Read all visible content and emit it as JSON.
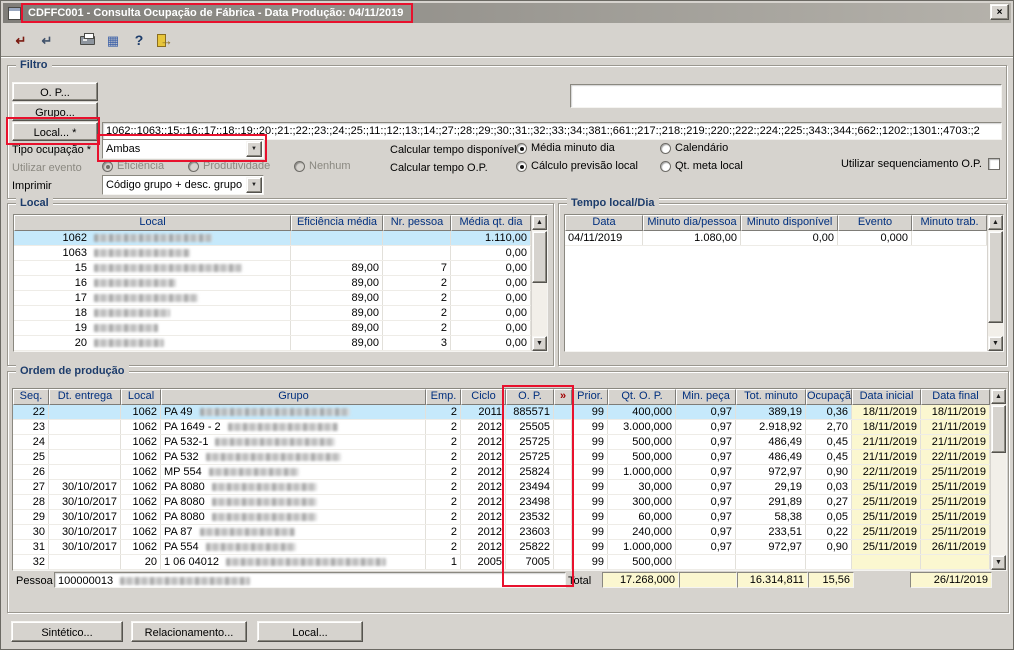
{
  "ui": {
    "arrow_up": "▲",
    "arrow_down": "▼",
    "chevron": "▼",
    "close": "×"
  },
  "annotation_color": "#e8112d",
  "window": {
    "title": "CDFFC001 - Consulta Ocupação de Fábrica - Data Produção: 04/11/2019"
  },
  "toolbar": {
    "icons": [
      {
        "name": "run-icon",
        "glyph": "↵"
      },
      {
        "name": "run-group-icon",
        "glyph": "↵"
      },
      {
        "name": "print-icon",
        "glyph": ""
      },
      {
        "name": "grid-icon",
        "glyph": "▦"
      },
      {
        "name": "help-icon",
        "glyph": "?"
      },
      {
        "name": "exit-icon",
        "glyph": "→"
      }
    ]
  },
  "filtro": {
    "legend": "Filtro",
    "op_button": "O. P...",
    "grupo_button": "Grupo...",
    "local_button": "Local... *",
    "local_list": "1062:;1063:;15:;16:;17:;18:;19:;20:;21:;22:;23:;24:;25:;11:;12:;13:;14:;27:;28:;29:;30:;31:;32:;33:;34:;381:;661:;217:;218:;219:;220:;222:;224:;225:;343:;344:;662:;1202:;1301:;4703:;2",
    "tipo_label": "Tipo ocupação *",
    "tipo_value": "Ambas",
    "evento_label": "Utilizar evento",
    "evento_options": [
      "Eficiência",
      "Produtividade",
      "Nenhum"
    ],
    "calc_disp_label": "Calcular tempo disponível",
    "calc_disp_options": [
      "Média minuto dia",
      "Calendário"
    ],
    "calc_op_label": "Calcular tempo O.P.",
    "calc_op_options": [
      "Cálculo previsão local",
      "Qt. meta local"
    ],
    "seq_label": "Utilizar sequenciamento O.P.",
    "imprimir_label": "Imprimir",
    "imprimir_value": "Código grupo + desc. grupo"
  },
  "local_panel": {
    "legend": "Local",
    "headers": [
      "Local",
      "Eficiência média",
      "Nr. pessoa",
      "Média qt. dia"
    ],
    "rows": [
      {
        "local": "1062",
        "blur": 118,
        "ef": "",
        "np": "",
        "mq": "1.110,00",
        "selected": true
      },
      {
        "local": "1063",
        "blur": 96,
        "ef": "",
        "np": "",
        "mq": "0,00"
      },
      {
        "local": "15",
        "blur": 148,
        "ef": "89,00",
        "np": "7",
        "mq": "0,00"
      },
      {
        "local": "16",
        "blur": 82,
        "ef": "89,00",
        "np": "2",
        "mq": "0,00"
      },
      {
        "local": "17",
        "blur": 104,
        "ef": "89,00",
        "np": "2",
        "mq": "0,00"
      },
      {
        "local": "18",
        "blur": 76,
        "ef": "89,00",
        "np": "2",
        "mq": "0,00"
      },
      {
        "local": "19",
        "blur": 64,
        "ef": "89,00",
        "np": "2",
        "mq": "0,00"
      },
      {
        "local": "20",
        "blur": 70,
        "ef": "89,00",
        "np": "3",
        "mq": "0,00"
      }
    ]
  },
  "tempo_panel": {
    "legend": "Tempo local/Dia",
    "headers": [
      "Data",
      "Minuto dia/pessoa",
      "Minuto disponível",
      "Evento",
      "Minuto trab."
    ],
    "rows": [
      {
        "data": "04/11/2019",
        "mdp": "1.080,00",
        "md": "0,00",
        "ev": "0,000",
        "mt": ""
      }
    ]
  },
  "ordem_panel": {
    "legend": "Ordem de produção",
    "headers": [
      "Seq.",
      "Dt. entrega",
      "Local",
      "Grupo",
      "Emp.",
      "Ciclo",
      "O. P.",
      "»",
      "Prior.",
      "Qt. O. P.",
      "Min. peça",
      "Tot. minuto",
      "Ocupação",
      "Data inicial",
      "Data final"
    ],
    "rows": [
      {
        "seq": "22",
        "dt": "",
        "local": "1062",
        "grupo": "PA 49",
        "blur": 150,
        "emp": "2",
        "ciclo": "2011",
        "op": "885571",
        "prior": "99",
        "qt": "400,000",
        "min": "0,97",
        "tot": "389,19",
        "ocup": "0,36",
        "di": "18/11/2019",
        "df": "18/11/2019",
        "selected": true
      },
      {
        "seq": "23",
        "dt": "",
        "local": "1062",
        "grupo": "PA 1649 - 2",
        "blur": 110,
        "emp": "2",
        "ciclo": "2012",
        "op": "25505",
        "prior": "99",
        "qt": "3.000,000",
        "min": "0,97",
        "tot": "2.918,92",
        "ocup": "2,70",
        "di": "18/11/2019",
        "df": "21/11/2019"
      },
      {
        "seq": "24",
        "dt": "",
        "local": "1062",
        "grupo": "PA 532-1",
        "blur": 120,
        "emp": "2",
        "ciclo": "2012",
        "op": "25725",
        "prior": "99",
        "qt": "500,000",
        "min": "0,97",
        "tot": "486,49",
        "ocup": "0,45",
        "di": "21/11/2019",
        "df": "21/11/2019"
      },
      {
        "seq": "25",
        "dt": "",
        "local": "1062",
        "grupo": "PA 532",
        "blur": 135,
        "emp": "2",
        "ciclo": "2012",
        "op": "25725",
        "prior": "99",
        "qt": "500,000",
        "min": "0,97",
        "tot": "486,49",
        "ocup": "0,45",
        "di": "21/11/2019",
        "df": "22/11/2019"
      },
      {
        "seq": "26",
        "dt": "",
        "local": "1062",
        "grupo": "MP 554",
        "blur": 90,
        "emp": "2",
        "ciclo": "2012",
        "op": "25824",
        "prior": "99",
        "qt": "1.000,000",
        "min": "0,97",
        "tot": "972,97",
        "ocup": "0,90",
        "di": "22/11/2019",
        "df": "25/11/2019"
      },
      {
        "seq": "27",
        "dt": "30/10/2017",
        "local": "1062",
        "grupo": "PA 8080",
        "blur": 105,
        "emp": "2",
        "ciclo": "2012",
        "op": "23494",
        "prior": "99",
        "qt": "30,000",
        "min": "0,97",
        "tot": "29,19",
        "ocup": "0,03",
        "di": "25/11/2019",
        "df": "25/11/2019"
      },
      {
        "seq": "28",
        "dt": "30/10/2017",
        "local": "1062",
        "grupo": "PA 8080",
        "blur": 105,
        "emp": "2",
        "ciclo": "2012",
        "op": "23498",
        "prior": "99",
        "qt": "300,000",
        "min": "0,97",
        "tot": "291,89",
        "ocup": "0,27",
        "di": "25/11/2019",
        "df": "25/11/2019"
      },
      {
        "seq": "29",
        "dt": "30/10/2017",
        "local": "1062",
        "grupo": "PA 8080",
        "blur": 105,
        "emp": "2",
        "ciclo": "2012",
        "op": "23532",
        "prior": "99",
        "qt": "60,000",
        "min": "0,97",
        "tot": "58,38",
        "ocup": "0,05",
        "di": "25/11/2019",
        "df": "25/11/2019"
      },
      {
        "seq": "30",
        "dt": "30/10/2017",
        "local": "1062",
        "grupo": "PA 87",
        "blur": 95,
        "emp": "2",
        "ciclo": "2012",
        "op": "23603",
        "prior": "99",
        "qt": "240,000",
        "min": "0,97",
        "tot": "233,51",
        "ocup": "0,22",
        "di": "25/11/2019",
        "df": "25/11/2019"
      },
      {
        "seq": "31",
        "dt": "30/10/2017",
        "local": "1062",
        "grupo": "PA 554",
        "blur": 90,
        "emp": "2",
        "ciclo": "2012",
        "op": "25822",
        "prior": "99",
        "qt": "1.000,000",
        "min": "0,97",
        "tot": "972,97",
        "ocup": "0,90",
        "di": "25/11/2019",
        "df": "26/11/2019"
      },
      {
        "seq": "32",
        "dt": "",
        "local": "20",
        "grupo": "1 06 04012",
        "blur": 160,
        "emp": "1",
        "ciclo": "2005",
        "op": "7005",
        "prior": "99",
        "qt": "500,000",
        "min": "",
        "tot": "",
        "ocup": "",
        "di": "",
        "df": ""
      }
    ],
    "pessoa_label": "Pessoa",
    "pessoa_code": "100000013",
    "total_label": "Total",
    "totals": {
      "qt": "17.268,000",
      "min": "",
      "tot": "16.314,811",
      "ocup": "15,56",
      "df": "26/11/2019"
    }
  },
  "footer": {
    "sintetico": "Sintético...",
    "relacionamento": "Relacionamento...",
    "local": "Local..."
  }
}
